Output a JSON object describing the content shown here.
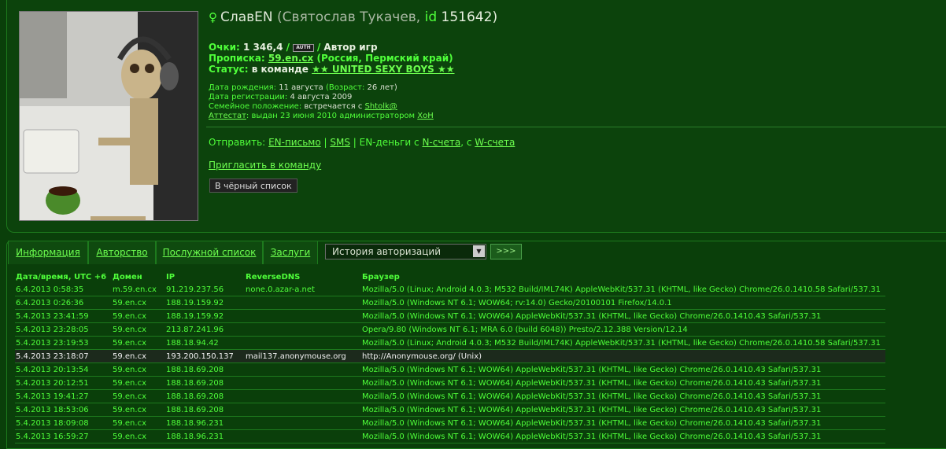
{
  "profile": {
    "nick": "СлавЕN",
    "realname": "(Святослав Тукачев,",
    "id_label": "id",
    "id_value": "151642)",
    "points_label": "Очки:",
    "points_value": "1 346,4",
    "auth_badge": "AUTH",
    "role": "Автор игр",
    "propiska_label": "Прописка:",
    "propiska_link": "59.en.cx",
    "propiska_region": "(Россия, Пермский край)",
    "status_label": "Статус:",
    "status_text": "в команде",
    "team_link": "★★ UNITED SEXY BOYS ★★",
    "birth_label": "Дата рождения:",
    "birth_value": "11 августа",
    "age_label": "(Возраст:",
    "age_value": "26 лет)",
    "reg_label": "Дата регистрации:",
    "reg_value": "4 августа 2009",
    "family_label": "Семейное положение:",
    "family_value": "встречается с",
    "family_link": "Shtolk@",
    "attestat_link": "Аттестат",
    "attestat_text": ": выдан 23 июня 2010 администратором",
    "attestat_admin": "XoH"
  },
  "actions": {
    "send_label": "Отправить:",
    "en_letter": "EN-письмо",
    "sms": "SMS",
    "en_money": "EN-деньги с",
    "n_account": "N-счета",
    "w_prefix": ", с",
    "w_account": "W-счета",
    "invite": "Пригласить в команду",
    "blacklist": "В чёрный список"
  },
  "tabs": [
    "Информация",
    "Авторство",
    "Послужной список",
    "Заслуги"
  ],
  "history_select": "История авторизаций",
  "go_button": ">>>",
  "table": {
    "headers": [
      "Дата/время, UTC +6",
      "Домен",
      "IP",
      "ReverseDNS",
      "Браузер"
    ],
    "rows": [
      [
        "6.4.2013 0:58:35",
        "m.59.en.cx",
        "91.219.237.56",
        "none.0.azar-a.net",
        "Mozilla/5.0 (Linux; Android 4.0.3; M532 Build/IML74K) AppleWebKit/537.31 (KHTML, like Gecko) Chrome/26.0.1410.58 Safari/537.31"
      ],
      [
        "6.4.2013 0:26:36",
        "59.en.cx",
        "188.19.159.92",
        "",
        "Mozilla/5.0 (Windows NT 6.1; WOW64; rv:14.0) Gecko/20100101 Firefox/14.0.1"
      ],
      [
        "5.4.2013 23:41:59",
        "59.en.cx",
        "188.19.159.92",
        "",
        "Mozilla/5.0 (Windows NT 6.1; WOW64) AppleWebKit/537.31 (KHTML, like Gecko) Chrome/26.0.1410.43 Safari/537.31"
      ],
      [
        "5.4.2013 23:28:05",
        "59.en.cx",
        "213.87.241.96",
        "",
        "Opera/9.80 (Windows NT 6.1; MRA 6.0 (build 6048)) Presto/2.12.388 Version/12.14"
      ],
      [
        "5.4.2013 23:19:53",
        "59.en.cx",
        "188.18.94.42",
        "",
        "Mozilla/5.0 (Linux; Android 4.0.3; M532 Build/IML74K) AppleWebKit/537.31 (KHTML, like Gecko) Chrome/26.0.1410.58 Safari/537.31"
      ],
      [
        "5.4.2013 23:18:07",
        "59.en.cx",
        "193.200.150.137",
        "mail137.anonymouse.org",
        "http://Anonymouse.org/ (Unix)"
      ],
      [
        "5.4.2013 20:13:54",
        "59.en.cx",
        "188.18.69.208",
        "",
        "Mozilla/5.0 (Windows NT 6.1; WOW64) AppleWebKit/537.31 (KHTML, like Gecko) Chrome/26.0.1410.43 Safari/537.31"
      ],
      [
        "5.4.2013 20:12:51",
        "59.en.cx",
        "188.18.69.208",
        "",
        "Mozilla/5.0 (Windows NT 6.1; WOW64) AppleWebKit/537.31 (KHTML, like Gecko) Chrome/26.0.1410.43 Safari/537.31"
      ],
      [
        "5.4.2013 19:41:27",
        "59.en.cx",
        "188.18.69.208",
        "",
        "Mozilla/5.0 (Windows NT 6.1; WOW64) AppleWebKit/537.31 (KHTML, like Gecko) Chrome/26.0.1410.43 Safari/537.31"
      ],
      [
        "5.4.2013 18:53:06",
        "59.en.cx",
        "188.18.69.208",
        "",
        "Mozilla/5.0 (Windows NT 6.1; WOW64) AppleWebKit/537.31 (KHTML, like Gecko) Chrome/26.0.1410.43 Safari/537.31"
      ],
      [
        "5.4.2013 18:09:08",
        "59.en.cx",
        "188.18.96.231",
        "",
        "Mozilla/5.0 (Windows NT 6.1; WOW64) AppleWebKit/537.31 (KHTML, like Gecko) Chrome/26.0.1410.43 Safari/537.31"
      ],
      [
        "5.4.2013 16:59:27",
        "59.en.cx",
        "188.18.96.231",
        "",
        "Mozilla/5.0 (Windows NT 6.1; WOW64) AppleWebKit/537.31 (KHTML, like Gecko) Chrome/26.0.1410.43 Safari/537.31"
      ]
    ],
    "highlight_row": 5
  }
}
